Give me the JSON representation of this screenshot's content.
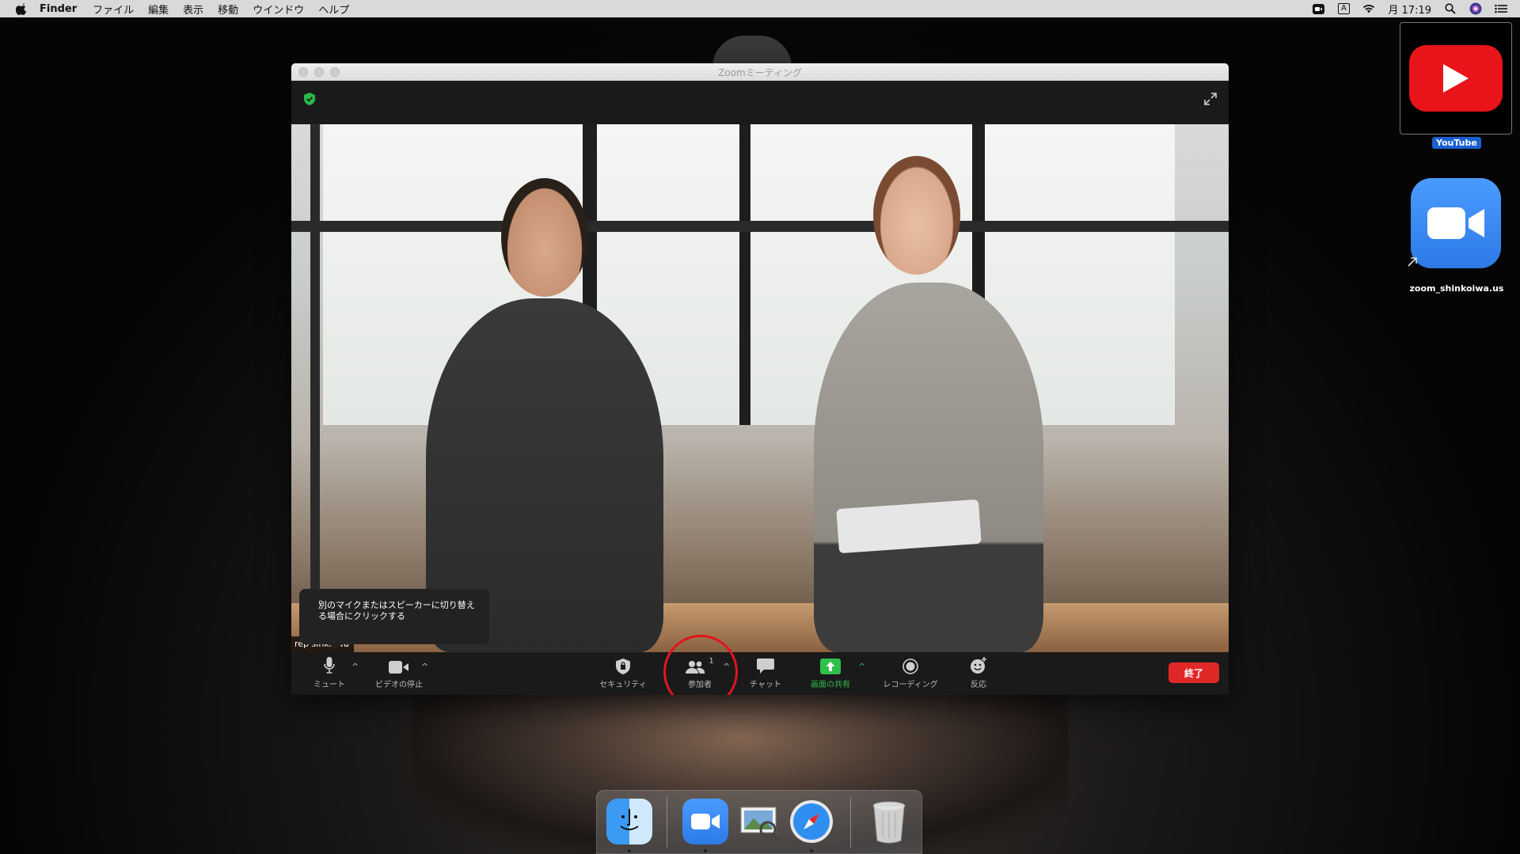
{
  "menubar": {
    "app_name": "Finder",
    "menus": [
      "ファイル",
      "編集",
      "表示",
      "移動",
      "ウインドウ",
      "ヘルプ"
    ],
    "input_indicator": "A",
    "clock": "月 17:19"
  },
  "zoom": {
    "window_title": "Zoomミーティング",
    "tooltip": "別のマイクまたはスピーカーに切り替える場合にクリックする",
    "participant_name": "rep sinkoiwa",
    "toolbar": {
      "mute": "ミュート",
      "video": "ビデオの停止",
      "security": "セキュリティ",
      "participants": "参加者",
      "participant_count": "1",
      "chat": "チャット",
      "share": "画面の共有",
      "record": "レコーディング",
      "reactions": "反応",
      "end": "終了"
    },
    "colors": {
      "share": "#2fbf4a",
      "end": "#e02828",
      "highlight": "#e0161c"
    }
  },
  "desktop": {
    "icons": [
      {
        "label": "YouTube",
        "icon": "youtube-icon"
      },
      {
        "label": "zoom_shinkoiwa.us",
        "icon": "zoom-icon"
      }
    ]
  },
  "dock": {
    "items": [
      "finder-icon",
      "zoom-icon",
      "preview-icon",
      "safari-icon",
      "trash-icon"
    ]
  }
}
